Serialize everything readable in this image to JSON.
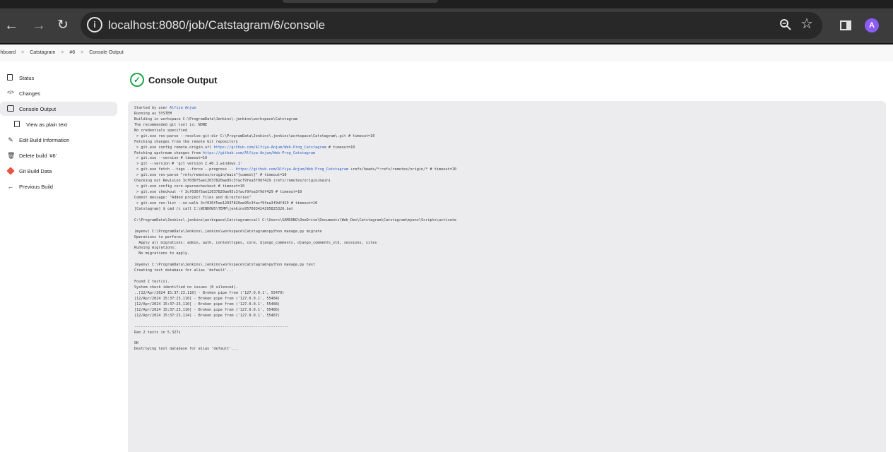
{
  "browser": {
    "url": "localhost:8080/job/Catstagram/6/console",
    "avatar_letter": "A",
    "icons": [
      "back-arrow-icon",
      "forward-arrow-icon",
      "reload-icon",
      "site-info-icon",
      "zoom-icon",
      "bookmark-star-icon",
      "side-panel-icon"
    ]
  },
  "breadcrumbs": [
    {
      "label": "ashboard"
    },
    {
      "label": "Catstagram"
    },
    {
      "label": "#6"
    },
    {
      "label": "Console Output"
    }
  ],
  "breadcrumb_separator": ">",
  "sidebar": {
    "items": [
      {
        "label": "Status",
        "icon": "status-doc-icon"
      },
      {
        "label": "Changes",
        "icon": "code-icon"
      },
      {
        "label": "Console Output",
        "icon": "terminal-icon"
      },
      {
        "label": "View as plain text",
        "icon": "document-icon"
      },
      {
        "label": "Edit Build Information",
        "icon": "edit-icon"
      },
      {
        "label": "Delete build ‘#6’",
        "icon": "trash-icon"
      },
      {
        "label": "Git Build Data",
        "icon": "git-icon"
      },
      {
        "label": "Previous Build",
        "icon": "arrow-left-icon"
      }
    ]
  },
  "main": {
    "title": "Console Output",
    "status_icon": "success-check-icon"
  },
  "console": {
    "lines": [
      {
        "pre": "Started by user ",
        "link": "Alfiya Anjum",
        "post": ""
      },
      {
        "text": "Running as SYSTEM"
      },
      {
        "text": "Building in workspace C:\\ProgramData\\Jenkins\\.jenkins\\workspace\\Catstagram"
      },
      {
        "text": "The recommended git tool is: NONE"
      },
      {
        "text": "No credentials specified"
      },
      {
        "text": " > git.exe rev-parse --resolve-git-dir C:\\ProgramData\\Jenkins\\.jenkins\\workspace\\Catstagram\\.git # timeout=10"
      },
      {
        "text": "Fetching changes from the remote Git repository"
      },
      {
        "pre": " > git.exe config remote.origin.url ",
        "link": "https://github.com/Alfiya-Anjum/Web-Prog_Catstagram",
        "post": " # timeout=10"
      },
      {
        "pre": "Fetching upstream changes from ",
        "link": "https://github.com/Alfiya-Anjum/Web-Prog_Catstagram",
        "post": ""
      },
      {
        "text": " > git.exe --version # timeout=10"
      },
      {
        "text": " > git --version # 'git version 2.40.1.windows.1'"
      },
      {
        "pre": " > git.exe fetch --tags --force --progress -- ",
        "link": "https://github.com/Alfiya-Anjum/Web-Prog_Catstagram",
        "post": " +refs/heads/*:refs/remotes/origin/* # timeout=10"
      },
      {
        "text": " > git.exe rev-parse \"refs/remotes/origin/main^{commit}\" # timeout=10"
      },
      {
        "text": "Checking out Revision 3cf036f5ae12037820ae95c3facf9fea3f9df429 (refs/remotes/origin/main)"
      },
      {
        "text": " > git.exe config core.sparsecheckout # timeout=10"
      },
      {
        "text": " > git.exe checkout -f 3cf036f5ae12037820ae95c3facf9fea3f9df429 # timeout=10"
      },
      {
        "text": "Commit message: \"Added project files and directories\""
      },
      {
        "text": " > git.exe rev-list --no-walk 3cf036f5ae12037820ae95c3facf9fea3f9df429 # timeout=10"
      },
      {
        "text": "[Catstagram] $ cmd /c call C:\\WINDOWS\\TEMP\\jenkins957663424295825326.bat"
      },
      {
        "text": ""
      },
      {
        "text": "C:\\ProgramData\\Jenkins\\.jenkins\\workspace\\Catstagram>call C:\\Users\\SAMSUNG\\OneDrive\\Documents\\Web_Dev\\Catstagram\\Catstagram\\myenv\\Scripts\\activate"
      },
      {
        "text": ""
      },
      {
        "text": "(myenv) C:\\ProgramData\\Jenkins\\.jenkins\\workspace\\Catstagram>python manage.py migrate"
      },
      {
        "text": "Operations to perform:"
      },
      {
        "text": "  Apply all migrations: admin, auth, contenttypes, core, django_comments, django_comments_xtd, sessions, sites"
      },
      {
        "text": "Running migrations:"
      },
      {
        "text": "  No migrations to apply."
      },
      {
        "text": ""
      },
      {
        "text": "(myenv) C:\\ProgramData\\Jenkins\\.jenkins\\workspace\\Catstagram>python manage.py test"
      },
      {
        "text": "Creating test database for alias 'default'..."
      },
      {
        "text": ""
      },
      {
        "text": "Found 2 test(s)."
      },
      {
        "text": "System check identified no issues (0 silenced)."
      },
      {
        "text": "..[12/Apr/2024 15:37:23,110] - Broken pipe from ('127.0.0.1', 55479)"
      },
      {
        "text": "[12/Apr/2024 15:37:23,110] - Broken pipe from ('127.0.0.1', 55484)"
      },
      {
        "text": "[12/Apr/2024 15:37:23,110] - Broken pipe from ('127.0.0.1', 55488)"
      },
      {
        "text": "[12/Apr/2024 15:37:23,110] - Broken pipe from ('127.0.0.1', 55486)"
      },
      {
        "text": "[12/Apr/2024 15:37:23,114] - Broken pipe from ('127.0.0.1', 55487)"
      },
      {
        "text": ""
      },
      {
        "text": "----------------------------------------------------------------------"
      },
      {
        "text": "Ran 2 tests in 5.327s"
      },
      {
        "text": ""
      },
      {
        "text": "OK"
      },
      {
        "text": "Destroying test database for alias 'default'..."
      }
    ]
  }
}
